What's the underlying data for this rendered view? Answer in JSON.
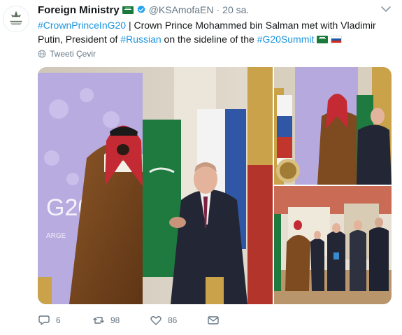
{
  "tweet": {
    "author_name": "Foreign Ministry",
    "author_handle": "@KSAmofaEN",
    "separator": "·",
    "time": "20 sa.",
    "text_parts": {
      "tag1": "#CrownPrinceInG20",
      "t1": " | Crown Prince Mohammed bin Salman met with Vladimir Putin, President of ",
      "tag2": "#Russian",
      "t2": " on the sideline of the ",
      "tag3": "#G20Summit"
    },
    "translate_label": "Tweeti Çevir",
    "media": {
      "backdrop_text": "G20",
      "backdrop_sub": "ARGE"
    },
    "actions": {
      "replies": "6",
      "retweets": "98",
      "likes": "86"
    }
  },
  "colors": {
    "link": "#1b95e0",
    "secondary": "#657786",
    "primary_text": "#14171a",
    "verified": "#1da1f2"
  },
  "icons": {
    "avatar": "ministry-emblem-icon",
    "verified": "verified-badge-icon",
    "caret": "chevron-down-icon",
    "translate": "globe-icon",
    "reply": "reply-icon",
    "retweet": "retweet-icon",
    "like": "heart-icon",
    "message": "envelope-icon"
  }
}
